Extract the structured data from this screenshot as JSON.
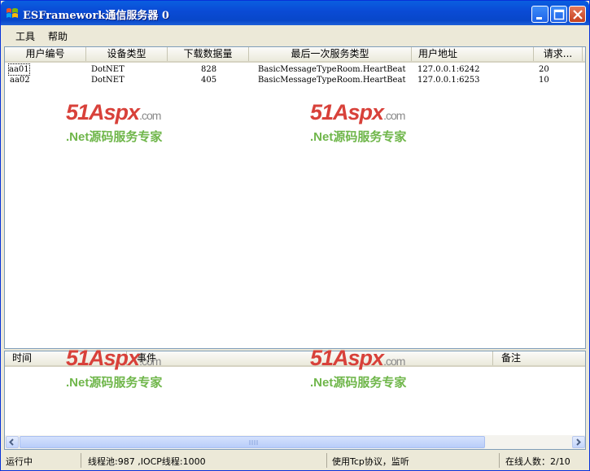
{
  "window": {
    "title": "ESFramework通信服务器 0"
  },
  "menu": [
    {
      "label": "工具"
    },
    {
      "label": "帮助"
    }
  ],
  "user_table": {
    "columns": [
      "用户编号",
      "设备类型",
      "下载数据量",
      "最后一次服务类型",
      "用户地址",
      "请求..."
    ],
    "rows": [
      [
        "aa01",
        "DotNET",
        "828",
        "BasicMessageTypeRoom.HeartBeat",
        "127.0.0.1:6242",
        "20"
      ],
      [
        "aa02",
        "DotNET",
        "405",
        "BasicMessageTypeRoom.HeartBeat",
        "127.0.0.1:6253",
        "10"
      ]
    ]
  },
  "log_table": {
    "columns": [
      "时间",
      "事件",
      "备注"
    ]
  },
  "status": {
    "state": "运行中",
    "threads": "线程池:987 ,IOCP线程:1000",
    "protocol": "使用Tcp协议，监听",
    "online": "在线人数：2/10"
  },
  "watermark": {
    "brand": "51Aspx",
    "domain": ".com",
    "slogan": ".Net源码服务专家"
  },
  "colors": {
    "titlebar": "#0a4bd6",
    "window_bg": "#ece9d8",
    "watermark_red": "#d8413a",
    "watermark_green": "#6fb64a"
  },
  "icons": [
    "windows-flag-icon",
    "minimize-icon",
    "maximize-icon",
    "close-icon",
    "scroll-left-icon",
    "scroll-right-icon"
  ]
}
